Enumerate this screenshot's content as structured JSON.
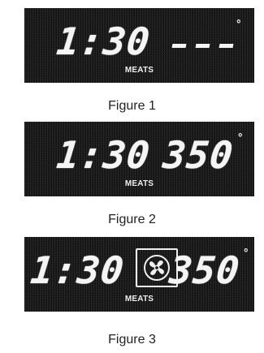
{
  "figures": [
    {
      "time": "1:30",
      "temp": "",
      "degree": "°",
      "mode": "MEATS",
      "caption": "Figure 1"
    },
    {
      "time": "1:30",
      "temp": "350",
      "degree": "°",
      "mode": "MEATS",
      "caption": "Figure 2"
    },
    {
      "time": "1:30",
      "temp": "350",
      "degree": "°",
      "mode": "MEATS",
      "caption": "Figure 3",
      "icon": "convection-fan-icon"
    }
  ]
}
